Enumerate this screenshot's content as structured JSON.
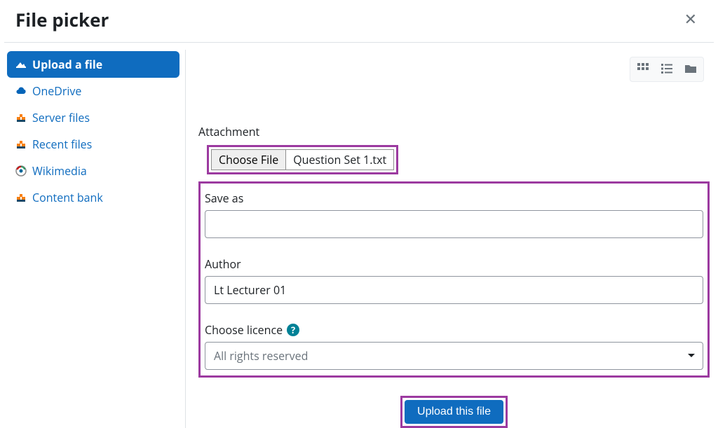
{
  "header": {
    "title": "File picker"
  },
  "sidebar": {
    "items": [
      {
        "label": "Upload a file"
      },
      {
        "label": "OneDrive"
      },
      {
        "label": "Server files"
      },
      {
        "label": "Recent files"
      },
      {
        "label": "Wikimedia"
      },
      {
        "label": "Content bank"
      }
    ]
  },
  "form": {
    "attachment_label": "Attachment",
    "choose_file_label": "Choose File",
    "chosen_file_name": "Question Set 1.txt",
    "save_as_label": "Save as",
    "save_as_value": "",
    "author_label": "Author",
    "author_value": "Lt Lecturer 01",
    "licence_label": "Choose licence",
    "licence_selected": "All rights reserved",
    "upload_label": "Upload this file"
  }
}
